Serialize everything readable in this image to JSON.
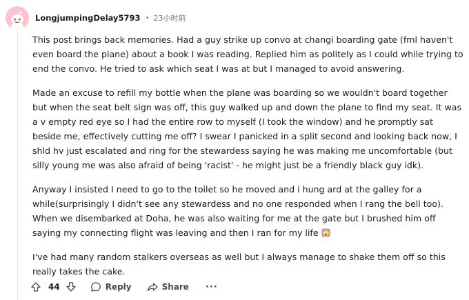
{
  "comment": {
    "username": "LongjumpingDelay5793",
    "separator": "•",
    "timestamp": "23小时前",
    "paragraphs": [
      "This post brings back memories. Had a guy strike up convo at changi boarding gate (fml haven't even board the plane) about a book I was reading. Replied him as politely as I could while trying to end the convo. He tried to ask which seat I was at but I managed to avoid answering.",
      "Made an excuse to refill my bottle when the plane was boarding so we wouldn't board together but when the seat belt sign was off, this guy walked up and down the plane to find my seat. It was a v empty red eye so I had the entire row to myself (I took the window) and he promptly sat beside me, effectively cutting me off? I swear I panicked in a split second and looking back now, I shld hv just escalated and ring for the stewardess saying he was making me uncomfortable (but silly young me was also afraid of being 'racist' - he might just be a friendly black guy idk).",
      "Anyway I insisted I need to go to the toilet so he moved and i hung ard at the galley for a while(surprisingly I didn't see any stewardess and no one responded when I rang the bell too). When we disembarked at Doha, he was also waiting for me at the gate but I brushed him off saying my connecting flight was leaving and then I ran for my life",
      "I've had many random stalkers overseas as well but I always manage to shake them off so this really takes the cake."
    ],
    "emoji_icon": "screaming-face-emoji"
  },
  "actions": {
    "vote_count": "44",
    "reply_label": "Reply",
    "share_label": "Share",
    "more_label": "···"
  },
  "colors": {
    "avatar_bg": "#fbc3cf",
    "text": "#1c1c1c",
    "meta": "#7c7c7c"
  }
}
